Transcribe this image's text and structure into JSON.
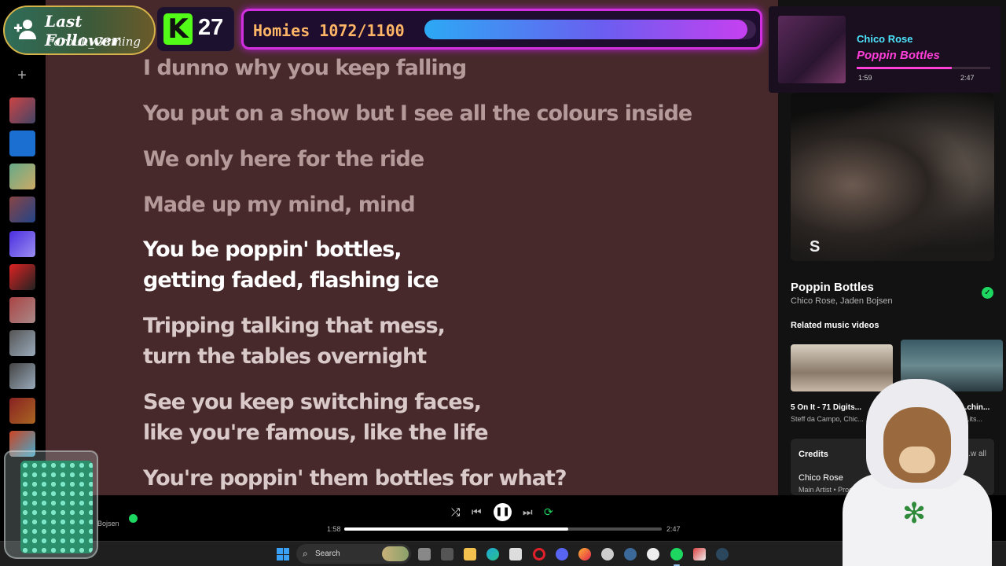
{
  "lyrics": {
    "lines": [
      {
        "text": "I dunno why you keep falling",
        "state": "past"
      },
      {
        "text": "You put on a show but I see all the colours inside",
        "state": "past"
      },
      {
        "text": "We only here for the ride",
        "state": "past"
      },
      {
        "text": "Made up my mind, mind",
        "state": "past"
      },
      {
        "text": "You be poppin' bottles,",
        "state": "active"
      },
      {
        "text": "getting faded, flashing ice",
        "state": "active"
      },
      {
        "text": "Tripping talking that mess,",
        "state": "future"
      },
      {
        "text": "turn the tables overnight",
        "state": "future"
      },
      {
        "text": "See you keep switching faces,",
        "state": "future"
      },
      {
        "text": "like you're famous, like the life",
        "state": "future"
      },
      {
        "text": "You're poppin' them bottles for what?",
        "state": "future"
      }
    ]
  },
  "right_panel": {
    "title": "Poppin Bottles",
    "artists": "Chico Rose, Jaden Bojsen",
    "logo_glyph": "S",
    "related_heading": "Related music videos",
    "related": [
      {
        "title": "5 On It - 71 Digits...",
        "subtitle": "Steff da Campo, Chic..."
      },
      {
        "title": "...chin...",
        "subtitle": "...its..."
      }
    ],
    "credits": {
      "heading": "Credits",
      "show_all": "...w all",
      "name": "Chico Rose",
      "role": "Main Artist • Produ..."
    }
  },
  "player": {
    "elapsed": "1:58",
    "duration": "2:47",
    "progress": 0.706,
    "now_playing_artist": "Bojsen",
    "controls": {
      "shuffle": "⤮",
      "prev": "⏮",
      "play_pause": "❚❚",
      "next": "⏭",
      "repeat": "⟳"
    }
  },
  "taskbar": {
    "search_label": "Search",
    "search_icon": "⌕"
  },
  "overlays": {
    "follower": {
      "label": "Last Follower",
      "name": "Farouk_Gaming",
      "icon": "👤+"
    },
    "kick": {
      "logo": "K",
      "count": "27"
    },
    "goal": {
      "label": "Homies 1072/1100",
      "progress": 0.9745
    },
    "now_playing_widget": {
      "artist": "Chico Rose",
      "title": "Poppin Bottles",
      "elapsed": "1:59",
      "duration": "2:47",
      "progress": 0.712
    }
  },
  "colors": {
    "lyrics_bg": "#47292b",
    "spotify_green": "#1ed760",
    "goal_border": "#d12fe0",
    "kick_green": "#53fc18"
  }
}
